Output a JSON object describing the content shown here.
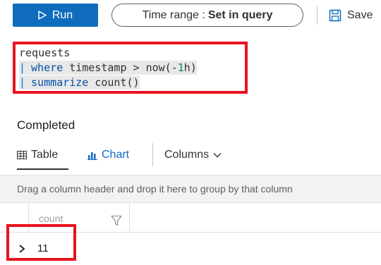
{
  "toolbar": {
    "run_label": "Run",
    "time_range_prefix": "Time range :",
    "time_range_value": "Set in query",
    "save_label": "Save"
  },
  "query": {
    "lines": [
      {
        "pipe": "",
        "keyword": "",
        "text": "requests"
      },
      {
        "pipe": "|",
        "keyword": "where",
        "text": "timestamp > now(-",
        "number": "1",
        "suffix": "h)"
      },
      {
        "pipe": "|",
        "keyword": "summarize",
        "text": "count()"
      }
    ]
  },
  "status": "Completed",
  "tabs": {
    "table": "Table",
    "chart": "Chart",
    "columns": "Columns"
  },
  "group_hint": "Drag a column header and drop it here to group by that column",
  "grid": {
    "columns": [
      "count"
    ],
    "rows": [
      {
        "count": "11"
      }
    ]
  },
  "highlight_color": "#e8141f",
  "accent_color": "#0f6cbd"
}
